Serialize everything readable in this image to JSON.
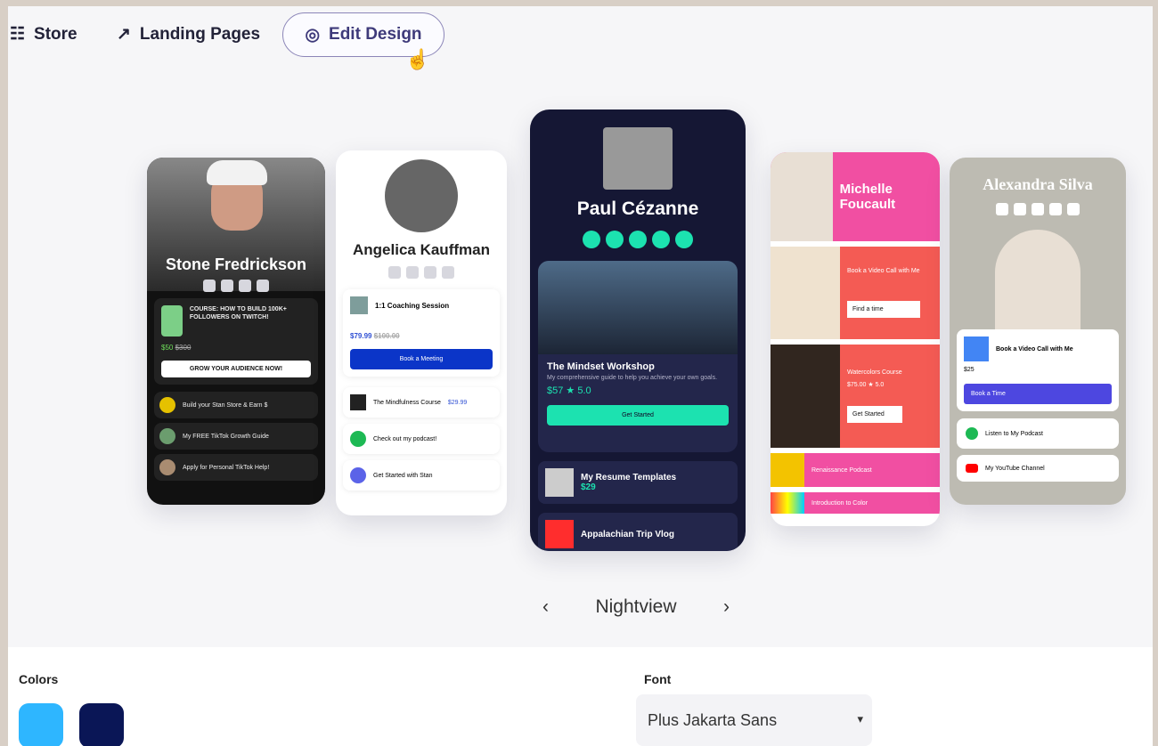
{
  "nav": {
    "store": "Store",
    "landing": "Landing Pages",
    "edit": "Edit Design"
  },
  "cards": {
    "stone": {
      "name": "Stone Fredrickson",
      "course": "COURSE: HOW TO BUILD 100K+ FOLLOWERS ON TWITCH!",
      "price": "$50",
      "old": "$300",
      "cta": "GROW YOUR AUDIENCE NOW!",
      "items": [
        "Build your Stan Store & Earn $",
        "My FREE TikTok Growth Guide",
        "Apply for Personal TikTok Help!"
      ]
    },
    "angelica": {
      "name": "Angelica Kauffman",
      "session": "1:1 Coaching Session",
      "price": "$79.99",
      "old": "$100.00",
      "cta": "Book a Meeting",
      "items": [
        "The Mindfulness Course",
        "Check out my podcast!",
        "Get Started with Stan"
      ],
      "course_price": "$29.99"
    },
    "paul": {
      "name": "Paul Cézanne",
      "workshop": "The Mindset Workshop",
      "desc": "My comprehensive guide to help you achieve your own goals.",
      "price": "$57",
      "rating": "5.0",
      "cta": "Get Started",
      "items": [
        "My Resume Templates",
        "Appalachian Trip Vlog"
      ],
      "resume_price": "$29"
    },
    "michelle": {
      "name": "Michelle Foucault",
      "book": "Book a Video Call with Me",
      "find": "Find a time",
      "course": "Watercolors Course",
      "price": "$75.00",
      "rating": "5.0",
      "cta": "Get Started",
      "podcast": "Renaissance Podcast",
      "intro": "Introduction to Color"
    },
    "alexandra": {
      "name": "Alexandra Silva",
      "book": "Book a Video Call with Me",
      "price": "$25",
      "time": "Book a Time",
      "items": [
        "Listen to My Podcast",
        "My YouTube Channel"
      ]
    }
  },
  "carousel": {
    "prev": "‹",
    "label": "Nightview",
    "next": "›"
  },
  "colors": {
    "label": "Colors",
    "swatches": [
      "#2eb6ff",
      "#0a1656"
    ]
  },
  "font": {
    "label": "Font",
    "value": "Plus Jakarta Sans",
    "arrow": "▾"
  }
}
